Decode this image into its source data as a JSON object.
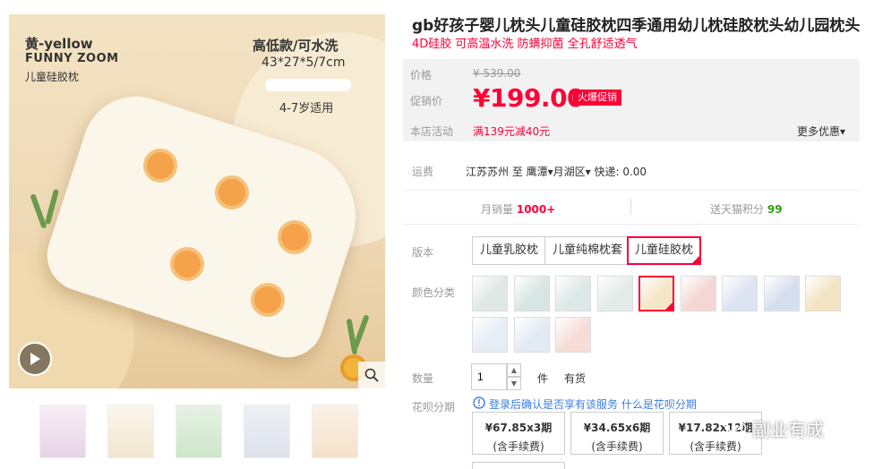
{
  "product": {
    "title": "gb好孩子婴儿枕头儿童硅胶枕四季通用幼儿枕硅胶枕头幼儿园枕头",
    "subtitle": "4D硅胶 可高温水洗 防螨抑菌 全孔舒适透气"
  },
  "main_image": {
    "brand_line1": "黄-yellow",
    "brand_line2": "FUNNY ZOOM",
    "brand_line3": "儿童硅胶枕",
    "spec_line1": "高低款/可水洗",
    "spec_line2": "43*27*5/7cm",
    "spec_line3": "4-7岁适用"
  },
  "price": {
    "orig_label": "价格",
    "orig_value": "¥ 539.00",
    "promo_label": "促销价",
    "promo_value": "¥199.00",
    "promo_badge": "火爆促销",
    "shop_label": "本店活动",
    "shop_value": "满139元减40元",
    "more_deals": "更多优惠▾"
  },
  "shipping": {
    "label": "运费",
    "text": "江苏苏州 至 鹰潭▾月湖区▾ 快递: 0.00"
  },
  "stats": {
    "sales_label": "月销量",
    "sales_value": "1000+",
    "points_label": "送天猫积分",
    "points_value": "99"
  },
  "version": {
    "label": "版本",
    "options": [
      "儿童乳胶枕",
      "儿童纯棉枕套",
      "儿童硅胶枕"
    ],
    "selected": "儿童硅胶枕"
  },
  "color": {
    "label": "颜色分类",
    "swatches": [
      "#dfe8e4",
      "#d7e6e2",
      "#dde9e6",
      "#e3ece8",
      "#f5e6c8",
      "#f4d7d3",
      "#dce3f1",
      "#d6dfef",
      "#f3e4c2",
      "#e5edf5",
      "#e2ebf4",
      "#f6ddd6"
    ],
    "selected_index": 4
  },
  "quantity": {
    "label": "数量",
    "value": "1",
    "unit": "件",
    "stock": "有货"
  },
  "huabei": {
    "label": "花呗分期",
    "info": "登录后确认是否享有该服务 什么是花呗分期",
    "plans": [
      {
        "amount": "¥67.85x3期",
        "fee": "(含手续费)"
      },
      {
        "amount": "¥34.65x6期",
        "fee": "(含手续费)"
      },
      {
        "amount": "¥17.82x12期",
        "fee": "(含手续费)"
      }
    ]
  },
  "watermark": "副业有成",
  "icons": {
    "play": "play-icon",
    "zoom": "search-icon",
    "info": "info-icon",
    "wechat": "wechat-icon"
  }
}
